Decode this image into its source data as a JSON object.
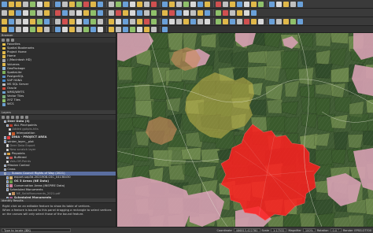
{
  "browser": {
    "title": "Browser",
    "items": [
      {
        "label": "Favorites",
        "icon": "star-icon",
        "color": "#e8c24a"
      },
      {
        "label": "Spatial Bookmarks",
        "icon": "bookmark-icon",
        "color": "#e8c24a"
      },
      {
        "label": "Project Home",
        "icon": "folder-icon",
        "color": "#e0b84a"
      },
      {
        "label": "Home",
        "icon": "folder-icon",
        "color": "#e0b84a"
      },
      {
        "label": "/ (Macintosh HD)",
        "icon": "drive-icon",
        "color": "#aaaaaa"
      },
      {
        "label": "Volumes",
        "icon": "folder-icon",
        "color": "#e0b84a"
      },
      {
        "label": "GeoPackage",
        "icon": "geopackage-icon",
        "color": "#8fb7d9"
      },
      {
        "label": "SpatiaLite",
        "icon": "spatialite-icon",
        "color": "#7cb05a"
      },
      {
        "label": "PostgreSQL",
        "icon": "postgres-icon",
        "color": "#5b8fc7"
      },
      {
        "label": "SAP HANA",
        "icon": "hana-icon",
        "color": "#4a8ed0"
      },
      {
        "label": "MS SQL Server",
        "icon": "mssql-icon",
        "color": "#c0c0c0"
      },
      {
        "label": "Oracle",
        "icon": "oracle-icon",
        "color": "#d04a3a"
      },
      {
        "label": "WMS/WMTS",
        "icon": "wms-icon",
        "color": "#6ca0d0"
      },
      {
        "label": "Vector Tiles",
        "icon": "vector-tiles-icon",
        "color": "#7ab07a"
      },
      {
        "label": "XYZ Tiles",
        "icon": "xyz-tiles-icon",
        "color": "#8fc06a"
      },
      {
        "label": "WCS",
        "icon": "wcs-icon",
        "color": "#6ca0d0"
      }
    ]
  },
  "layers": {
    "title": "Layers",
    "items": [
      {
        "label": "Deer Data (3)",
        "indent": 1,
        "swatch": "",
        "checked": true,
        "style": "bold"
      },
      {
        "label": "ALL Pinchpoints",
        "indent": 2,
        "swatch": "#b33a2a",
        "checked": true,
        "style": ""
      },
      {
        "label": "Added gpkpts.hits",
        "indent": 3,
        "swatch": "",
        "checked": false,
        "style": "dim"
      },
      {
        "label": "Interpolation",
        "indent": 3,
        "swatch": "#c75a2a",
        "checked": false,
        "style": ""
      },
      {
        "label": "DNIA - PROJECT AREA",
        "indent": 1,
        "swatch": "#e04040",
        "checked": true,
        "style": "bold"
      },
      {
        "label": "winter_layer__plot",
        "indent": 1,
        "swatch": "",
        "checked": true,
        "style": ""
      },
      {
        "label": "Deer Data Export",
        "indent": 2,
        "swatch": "",
        "checked": false,
        "style": "dim"
      },
      {
        "label": "New scratch layer",
        "indent": 2,
        "swatch": "",
        "checked": false,
        "style": "dim"
      },
      {
        "label": "Pinpoints",
        "indent": 1,
        "swatch": "#d8a040",
        "checked": true,
        "style": ""
      },
      {
        "label": "Buffered",
        "indent": 2,
        "swatch": "#c05050",
        "checked": true,
        "style": ""
      },
      {
        "label": "Vals-Off-Points",
        "indent": 2,
        "swatch": "",
        "checked": false,
        "style": "dim"
      },
      {
        "label": "Mission Control",
        "indent": 1,
        "swatch": "",
        "checked": true,
        "style": ""
      },
      {
        "label": "Cross",
        "indent": 1,
        "swatch": "",
        "checked": true,
        "style": ""
      },
      {
        "label": "Sussex Council Rights of Way (2021)",
        "indent": 1,
        "swatch": "#6b7fb0",
        "checked": true,
        "style": "sel"
      },
      {
        "label": "export-sap3d-2021908-CSC_04138430",
        "indent": 2,
        "swatch": "#d0b070",
        "checked": true,
        "style": ""
      },
      {
        "label": "OS 5 Areas (NE Data)",
        "indent": 2,
        "swatch": "#6a9a4a",
        "checked": true,
        "style": "bold"
      },
      {
        "label": "Conservation Areas (INSPIRE Data)",
        "indent": 2,
        "swatch": "#d27a9a",
        "checked": true,
        "style": ""
      },
      {
        "label": "Scheduled Monuments",
        "indent": 2,
        "swatch": "",
        "checked": true,
        "style": ""
      },
      {
        "label": "NE_SoilsMonuments_2021.pdf",
        "indent": 3,
        "swatch": "#c09060",
        "checked": false,
        "style": "dim"
      },
      {
        "label": "Scheduled Monuments",
        "indent": 2,
        "swatch": "#a05a8a",
        "checked": true,
        "style": "bold"
      }
    ]
  },
  "identify": {
    "title": "Identify Results",
    "line1": "Right click on an editable feature to show its table of vertices.",
    "line2": "When a feature is bound to this panel dragging a rectangle to select vertices on the canvas will only select those of the bound feature.",
    "search_placeholder": "Type to locate (⌘K)"
  },
  "statusbar": {
    "coordinate_label": "Coordinate",
    "coordinate": "486813,422780",
    "scale_label": "Scale",
    "scale": "1:17532",
    "magnifier_label": "Magnifier",
    "magnifier": "100%",
    "rotation_label": "Rotation",
    "rotation": "0.0 °",
    "render_label": "Render",
    "crs": "EPSG:27700"
  },
  "toolbar_colors": {
    "row1": [
      "#6aa0d8",
      "#e0b84a",
      "#e0b84a",
      "#c0c0c0",
      "#8fc06a",
      "#d8d8d8",
      "#e0b84a",
      "#6aa0d8",
      "#c0c0c0",
      "#e0b84a",
      "#8fc06a",
      "#d05050",
      "#e0b84a",
      "#6aa0d8",
      "#c0c0c0",
      "#8fc06a",
      "#6aa0d8",
      "#d8d8d8",
      "#e0b84a",
      "#c0c0c0",
      "#d05050",
      "#6aa0d8",
      "#e0b84a",
      "#c0c0c0",
      "#8fc06a",
      "#d8d8d8",
      "#6aa0d8",
      "#e0b84a",
      "#d05050",
      "#c0c0c0",
      "#e0b84a",
      "#6aa0d8",
      "#d8d8d8",
      "#e0b84a",
      "#8fc06a",
      "#6aa0d8",
      "#d8d8d8",
      "#e0b84a",
      "#c0c0c0",
      "#6aa0d8"
    ],
    "row2": [
      "#c0c0c0",
      "#e0b84a",
      "#6aa0d8",
      "#d8d8d8",
      "#8fc06a",
      "#c0c0c0",
      "#e0b84a",
      "#d05050",
      "#6aa0d8",
      "#c0c0c0",
      "#d8d8d8",
      "#e0b84a",
      "#8fc06a",
      "#6aa0d8",
      "#c0c0c0",
      "#d05050",
      "#e0b84a",
      "#d8d8d8",
      "#6aa0d8",
      "#c0c0c0",
      "#8fc06a",
      "#e0b84a",
      "#d05050",
      "#6aa0d8",
      "#d8d8d8",
      "#c0c0c0",
      "#e0b84a",
      "#6aa0d8",
      "#8fc06a",
      "#d05050",
      "#c0c0c0",
      "#e0b84a",
      "#d8d8d8",
      "#6aa0d8"
    ],
    "row3": [
      "#e0b84a",
      "#6aa0d8",
      "#c0c0c0",
      "#d8d8d8",
      "#e0b84a",
      "#8fc06a",
      "#6aa0d8",
      "#c0c0c0",
      "#d05050",
      "#e0b84a",
      "#d8d8d8",
      "#6aa0d8",
      "#8fc06a",
      "#c0c0c0",
      "#e0b84a",
      "#d8d8d8",
      "#6aa0d8",
      "#c0c0c0",
      "#e0b84a",
      "#d05050",
      "#8fc06a",
      "#6aa0d8",
      "#d8d8d8",
      "#c0c0c0",
      "#e0b84a",
      "#6aa0d8",
      "#c0c0c0",
      "#d8d8d8",
      "#8fc06a",
      "#e0b84a",
      "#6aa0d8",
      "#c0c0c0",
      "#d05050",
      "#e0b84a",
      "#d8d8d8",
      "#6aa0d8",
      "#c0c0c0",
      "#e0b84a",
      "#8fc06a",
      "#6aa0d8"
    ],
    "row4": [
      "#e0b84a",
      "#6aa0d8",
      "#c0c0c0",
      "#d8d8d8",
      "#8fc06a",
      "#e0b84a",
      "#c0c0c0",
      "#6aa0d8",
      "#d8d8d8",
      "#e0b84a",
      "#c0c0c0",
      "#8fc06a",
      "#6aa0d8",
      "#d8d8d8",
      "#e0b84a",
      "#c0c0c0",
      "#6aa0d8",
      "#8fc06a",
      "#d8d8d8",
      "#e0b84a",
      "#c0c0c0",
      "#6aa0d8"
    ]
  },
  "map_colors": {
    "base": "#3f5a33",
    "field_light": "#6f8a4e",
    "field_dark": "#2f4a2a",
    "woodland": "#3a5a2c",
    "conservation": "#d6a0b2",
    "buffer_yellow": "#c8b84a",
    "buffer_orange": "#c98a5a",
    "project_area": "#ff2020"
  }
}
